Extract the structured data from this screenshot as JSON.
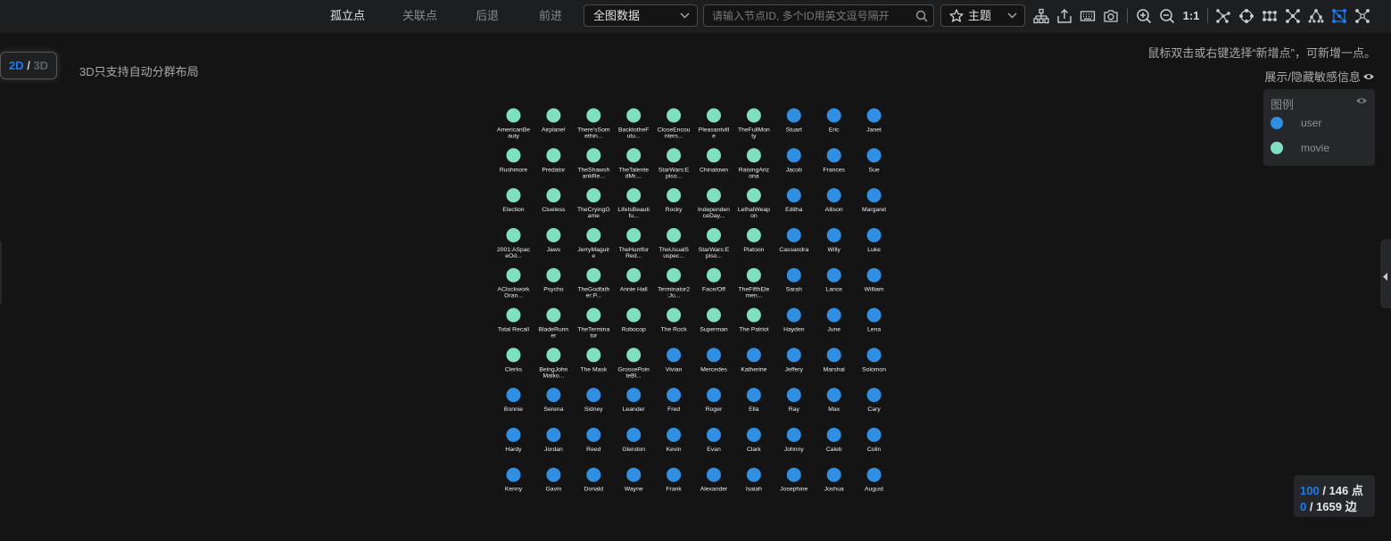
{
  "toolbar": {
    "tabs": [
      "孤立点",
      "关联点",
      "后退",
      "前进"
    ],
    "scope_select": "全图数据",
    "search_placeholder": "请输入节点ID, 多个ID用英文逗号隔开",
    "theme_label": "主题",
    "zoom_reset_label": "1:1",
    "icons": [
      "hierarchy-icon",
      "export-icon",
      "keyboard-icon",
      "camera-icon",
      "zoom-in-icon",
      "zoom-out-icon",
      "layout-tree-icon",
      "layout-circular-icon",
      "layout-grid-icon",
      "layout-force-icon",
      "layout-dagre-icon",
      "layout-cluster-icon",
      "layout-radial-icon"
    ]
  },
  "view": {
    "dim_2d": "2D",
    "dim_sep": "/",
    "dim_3d": "3D",
    "layout_note": "3D只支持自动分群布局",
    "hint": "鼠标双击或右键选择“新增点”，可新增一点。",
    "sensitive_toggle": "展示/隐藏敏感信息"
  },
  "legend": {
    "title": "图例",
    "items": [
      {
        "label": "user",
        "color": "#2f8fe3"
      },
      {
        "label": "movie",
        "color": "#7fe0bf"
      }
    ]
  },
  "graph": {
    "columns": 10,
    "nodes": [
      {
        "type": "movie",
        "l1": "AmericanBe",
        "l2": "auty"
      },
      {
        "type": "movie",
        "l1": "Airplane!"
      },
      {
        "type": "movie",
        "l1": "There'sSom",
        "l2": "ethin..."
      },
      {
        "type": "movie",
        "l1": "BacktotheF",
        "l2": "utu..."
      },
      {
        "type": "movie",
        "l1": "CloseEncou",
        "l2": "nters..."
      },
      {
        "type": "movie",
        "l1": "Pleasantvill",
        "l2": "e"
      },
      {
        "type": "movie",
        "l1": "TheFullMon",
        "l2": "ty"
      },
      {
        "type": "user",
        "l1": "Stuart"
      },
      {
        "type": "user",
        "l1": "Eric"
      },
      {
        "type": "user",
        "l1": "Janet"
      },
      {
        "type": "movie",
        "l1": "Rushmore"
      },
      {
        "type": "movie",
        "l1": "Predator"
      },
      {
        "type": "movie",
        "l1": "TheShawsh",
        "l2": "ankRe..."
      },
      {
        "type": "movie",
        "l1": "TheTalente",
        "l2": "dMr...."
      },
      {
        "type": "movie",
        "l1": "StarWars:E",
        "l2": "piso..."
      },
      {
        "type": "movie",
        "l1": "Chinatown"
      },
      {
        "type": "movie",
        "l1": "RaisingAriz",
        "l2": "ona"
      },
      {
        "type": "user",
        "l1": "Jacob"
      },
      {
        "type": "user",
        "l1": "Frances"
      },
      {
        "type": "user",
        "l1": "Sue"
      },
      {
        "type": "movie",
        "l1": "Election"
      },
      {
        "type": "movie",
        "l1": "Clueless"
      },
      {
        "type": "movie",
        "l1": "TheCryingG",
        "l2": "ame"
      },
      {
        "type": "movie",
        "l1": "LifeIsBeauti",
        "l2": "fu..."
      },
      {
        "type": "movie",
        "l1": "Rocky"
      },
      {
        "type": "movie",
        "l1": "Independen",
        "l2": "ceDay..."
      },
      {
        "type": "movie",
        "l1": "LethalWeap",
        "l2": "on"
      },
      {
        "type": "user",
        "l1": "Editha"
      },
      {
        "type": "user",
        "l1": "Allison"
      },
      {
        "type": "user",
        "l1": "Margaret"
      },
      {
        "type": "movie",
        "l1": "2001:ASpac",
        "l2": "eOd..."
      },
      {
        "type": "movie",
        "l1": "Jaws"
      },
      {
        "type": "movie",
        "l1": "JerryMaguir",
        "l2": "e"
      },
      {
        "type": "movie",
        "l1": "TheHuntfor",
        "l2": "Red..."
      },
      {
        "type": "movie",
        "l1": "TheUsualS",
        "l2": "uspec..."
      },
      {
        "type": "movie",
        "l1": "StarWars:E",
        "l2": "piso..."
      },
      {
        "type": "movie",
        "l1": "Platoon"
      },
      {
        "type": "user",
        "l1": "Cassandra"
      },
      {
        "type": "user",
        "l1": "Willy"
      },
      {
        "type": "user",
        "l1": "Luke"
      },
      {
        "type": "movie",
        "l1": "AClockwork",
        "l2": "Oran..."
      },
      {
        "type": "movie",
        "l1": "Psycho"
      },
      {
        "type": "movie",
        "l1": "TheGodfath",
        "l2": "er:P..."
      },
      {
        "type": "movie",
        "l1": "Annie Hall"
      },
      {
        "type": "movie",
        "l1": "Terminator2",
        "l2": ":Ju..."
      },
      {
        "type": "movie",
        "l1": "Face/Off"
      },
      {
        "type": "movie",
        "l1": "TheFifthEle",
        "l2": "men..."
      },
      {
        "type": "user",
        "l1": "Sarah"
      },
      {
        "type": "user",
        "l1": "Lance"
      },
      {
        "type": "user",
        "l1": "William"
      },
      {
        "type": "movie",
        "l1": "Total Recall"
      },
      {
        "type": "movie",
        "l1": "BladeRunn",
        "l2": "er"
      },
      {
        "type": "movie",
        "l1": "TheTermina",
        "l2": "tor"
      },
      {
        "type": "movie",
        "l1": "Robocop"
      },
      {
        "type": "movie",
        "l1": "The Rock"
      },
      {
        "type": "movie",
        "l1": "Superman"
      },
      {
        "type": "movie",
        "l1": "The Patriot"
      },
      {
        "type": "user",
        "l1": "Hayden"
      },
      {
        "type": "user",
        "l1": "June"
      },
      {
        "type": "user",
        "l1": "Lena"
      },
      {
        "type": "movie",
        "l1": "Clerks"
      },
      {
        "type": "movie",
        "l1": "BeingJohn",
        "l2": "Malko..."
      },
      {
        "type": "movie",
        "l1": "The Mask"
      },
      {
        "type": "movie",
        "l1": "GrossePoin",
        "l2": "teBl..."
      },
      {
        "type": "user",
        "l1": "Vivian"
      },
      {
        "type": "user",
        "l1": "Mercedes"
      },
      {
        "type": "user",
        "l1": "Katherine"
      },
      {
        "type": "user",
        "l1": "Jeffery"
      },
      {
        "type": "user",
        "l1": "Marshal"
      },
      {
        "type": "user",
        "l1": "Solomon"
      },
      {
        "type": "user",
        "l1": "Bonnie"
      },
      {
        "type": "user",
        "l1": "Serena"
      },
      {
        "type": "user",
        "l1": "Sidney"
      },
      {
        "type": "user",
        "l1": "Leander"
      },
      {
        "type": "user",
        "l1": "Fred"
      },
      {
        "type": "user",
        "l1": "Roger"
      },
      {
        "type": "user",
        "l1": "Ella"
      },
      {
        "type": "user",
        "l1": "Ray"
      },
      {
        "type": "user",
        "l1": "Max"
      },
      {
        "type": "user",
        "l1": "Cary"
      },
      {
        "type": "user",
        "l1": "Hardy"
      },
      {
        "type": "user",
        "l1": "Jordan"
      },
      {
        "type": "user",
        "l1": "Reed"
      },
      {
        "type": "user",
        "l1": "Glendon"
      },
      {
        "type": "user",
        "l1": "Kevin"
      },
      {
        "type": "user",
        "l1": "Evan"
      },
      {
        "type": "user",
        "l1": "Clark"
      },
      {
        "type": "user",
        "l1": "Johnny"
      },
      {
        "type": "user",
        "l1": "Caleb"
      },
      {
        "type": "user",
        "l1": "Colin"
      },
      {
        "type": "user",
        "l1": "Kenny"
      },
      {
        "type": "user",
        "l1": "Gavin"
      },
      {
        "type": "user",
        "l1": "Donald"
      },
      {
        "type": "user",
        "l1": "Wayne"
      },
      {
        "type": "user",
        "l1": "Frank"
      },
      {
        "type": "user",
        "l1": "Alexander"
      },
      {
        "type": "user",
        "l1": "Isaiah"
      },
      {
        "type": "user",
        "l1": "Josephine"
      },
      {
        "type": "user",
        "l1": "Joshua"
      },
      {
        "type": "user",
        "l1": "August"
      }
    ]
  },
  "stats": {
    "nodes_shown": "100",
    "nodes_total": " / 146 点",
    "edges_shown": "0",
    "edges_total": " / 1659 边"
  }
}
